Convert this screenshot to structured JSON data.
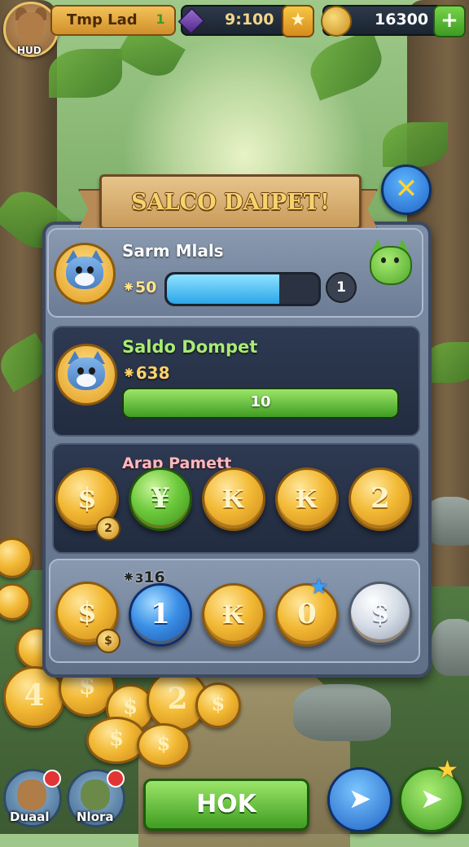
{
  "hud": {
    "avatar_label": "HUD",
    "player_name": "Tmp Lad",
    "level_icon": "1",
    "gems": "9:100",
    "star_icon": "★",
    "coins": "16300",
    "plus_icon": "+"
  },
  "dialog": {
    "title": "SALCO DAIPET!",
    "close_icon": "✕",
    "player": {
      "name": "Sarm Mlals",
      "gold": "⁕50",
      "xp_progress": 0.74,
      "level": "1"
    },
    "wallet": {
      "title": "Saldo Dompet",
      "amount": "⁕638",
      "bar_value": "10",
      "bar_progress": 1.0
    },
    "payment_row": {
      "label": "Arap Pamett",
      "coins": [
        {
          "symbol": "$",
          "style": "gold",
          "badge": "2"
        },
        {
          "symbol": "¥",
          "style": "green"
        },
        {
          "symbol": "₭",
          "style": "gold"
        },
        {
          "symbol": "₭",
          "style": "gold"
        },
        {
          "symbol": "2",
          "style": "gold"
        }
      ]
    },
    "reward_row": {
      "label": "⁕ɜ16",
      "coins": [
        {
          "symbol": "$",
          "style": "gold",
          "badge": "$"
        },
        {
          "symbol": "1",
          "style": "blue"
        },
        {
          "symbol": "₭",
          "style": "gold"
        },
        {
          "symbol": "0",
          "style": "gold",
          "star": "★"
        },
        {
          "symbol": "$",
          "style": "silver"
        }
      ]
    }
  },
  "pile": {
    "coin_4": "4",
    "coin_2": "2",
    "coin_s": "$"
  },
  "bottom": {
    "friend1": "Duaal",
    "friend2": "Nlora",
    "hok_label": "HOK",
    "send_icon": "➤"
  },
  "colors": {
    "accent_gold": "#f2b934",
    "accent_green": "#3f9d22",
    "accent_blue": "#1f63c6",
    "panel": "#6c7c94"
  }
}
